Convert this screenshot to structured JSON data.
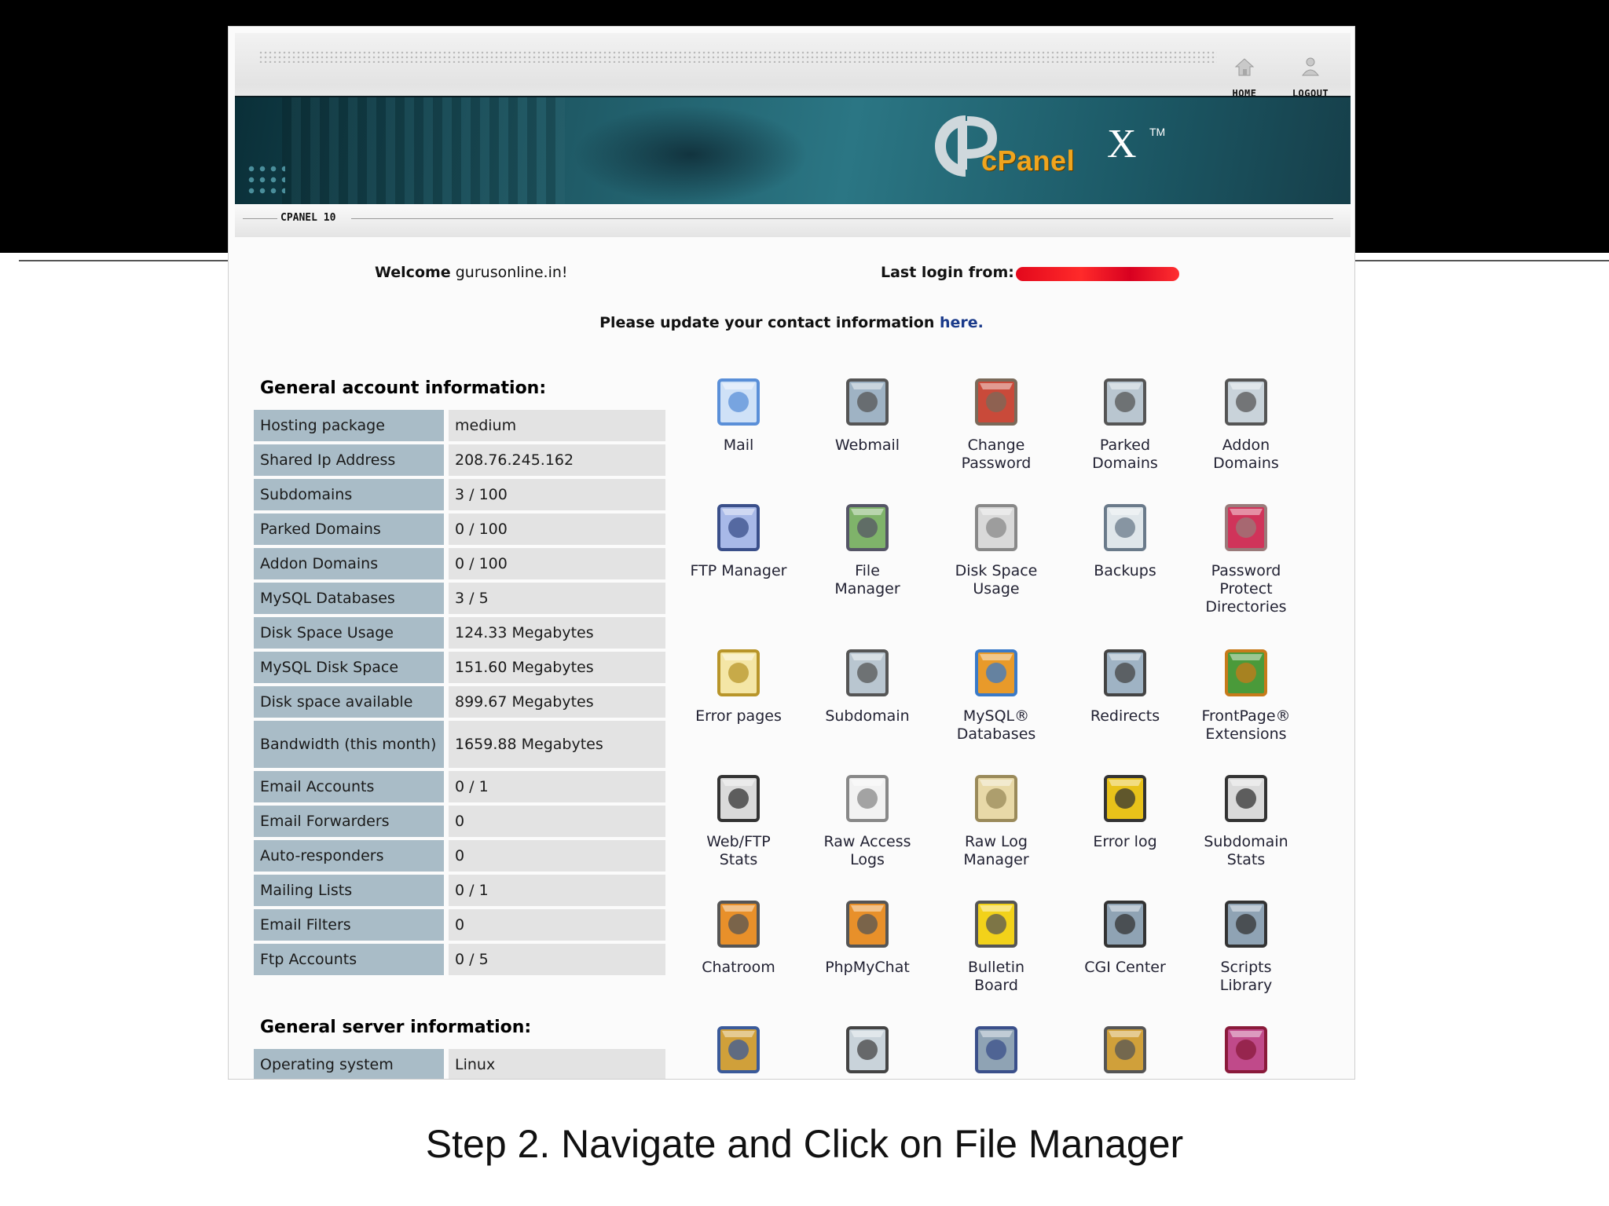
{
  "toolbar": {
    "home_label": "HOME",
    "logout_label": "LOGOUT"
  },
  "banner": {
    "logo_text": "cPanel",
    "logo_x": "X",
    "logo_tm": "TM"
  },
  "subbar": {
    "label": "CPANEL 10"
  },
  "welcome": {
    "prefix": "Welcome",
    "domain": "gurusonline.in!",
    "last_login_label": "Last login from:"
  },
  "notice": {
    "text": "Please update your contact information ",
    "link": "here."
  },
  "account": {
    "title": "General account information:",
    "rows": [
      {
        "k": "Hosting package",
        "v": "medium"
      },
      {
        "k": "Shared Ip Address",
        "v": "208.76.245.162"
      },
      {
        "k": "Subdomains",
        "v": "3 / 100"
      },
      {
        "k": "Parked Domains",
        "v": "0 / 100"
      },
      {
        "k": "Addon Domains",
        "v": "0 / 100"
      },
      {
        "k": "MySQL Databases",
        "v": "3 / 5"
      },
      {
        "k": "Disk Space Usage",
        "v": "124.33 Megabytes"
      },
      {
        "k": "MySQL Disk Space",
        "v": "151.60 Megabytes"
      },
      {
        "k": "Disk space available",
        "v": "899.67 Megabytes"
      },
      {
        "k": "Bandwidth (this month)",
        "v": "1659.88 Megabytes"
      },
      {
        "k": "Email Accounts",
        "v": "0 / 1"
      },
      {
        "k": "Email Forwarders",
        "v": "0"
      },
      {
        "k": "Auto-responders",
        "v": "0"
      },
      {
        "k": "Mailing Lists",
        "v": "0 / 1"
      },
      {
        "k": "Email Filters",
        "v": "0"
      },
      {
        "k": "Ftp Accounts",
        "v": "0 / 5"
      }
    ]
  },
  "server": {
    "title": "General server information:",
    "rows": [
      {
        "k": "Operating system",
        "v": "Linux"
      }
    ]
  },
  "icons": [
    {
      "label": "Mail",
      "icon": "mail-icon"
    },
    {
      "label": "Webmail",
      "icon": "webmail-icon"
    },
    {
      "label": "Change\nPassword",
      "icon": "change-password-icon"
    },
    {
      "label": "Parked\nDomains",
      "icon": "parked-domains-icon"
    },
    {
      "label": "Addon\nDomains",
      "icon": "addon-domains-icon"
    },
    {
      "label": "FTP Manager",
      "icon": "ftp-manager-icon"
    },
    {
      "label": "File\nManager",
      "icon": "file-manager-icon"
    },
    {
      "label": "Disk Space\nUsage",
      "icon": "disk-space-icon"
    },
    {
      "label": "Backups",
      "icon": "backups-icon"
    },
    {
      "label": "Password\nProtect\nDirectories",
      "icon": "password-protect-icon"
    },
    {
      "label": "Error pages",
      "icon": "error-pages-icon"
    },
    {
      "label": "Subdomain",
      "icon": "subdomain-icon"
    },
    {
      "label": "MySQL®\nDatabases",
      "icon": "mysql-icon"
    },
    {
      "label": "Redirects",
      "icon": "redirects-icon"
    },
    {
      "label": "FrontPage®\nExtensions",
      "icon": "frontpage-icon"
    },
    {
      "label": "Web/FTP\nStats",
      "icon": "web-ftp-stats-icon"
    },
    {
      "label": "Raw Access\nLogs",
      "icon": "raw-access-logs-icon"
    },
    {
      "label": "Raw Log\nManager",
      "icon": "raw-log-manager-icon"
    },
    {
      "label": "Error log",
      "icon": "error-log-icon"
    },
    {
      "label": "Subdomain\nStats",
      "icon": "subdomain-stats-icon"
    },
    {
      "label": "Chatroom",
      "icon": "chatroom-icon"
    },
    {
      "label": "PhpMyChat",
      "icon": "phpmychat-icon"
    },
    {
      "label": "Bulletin\nBoard",
      "icon": "bulletin-board-icon"
    },
    {
      "label": "CGI Center",
      "icon": "cgi-center-icon"
    },
    {
      "label": "Scripts\nLibrary",
      "icon": "scripts-library-icon"
    },
    {
      "label": "",
      "icon": "shopping-cart-icon"
    },
    {
      "label": "",
      "icon": "cron-jobs-icon"
    },
    {
      "label": "",
      "icon": "network-tools-icon"
    },
    {
      "label": "",
      "icon": "settings-gear-icon"
    },
    {
      "label": "",
      "icon": "apache-logo-icon"
    }
  ],
  "caption": "Step 2. Navigate and Click on File Manager",
  "colors": {
    "key_cell": "#a9bcc7",
    "value_cell": "#e3e3e3",
    "banner": "#1f5a66",
    "logo_orange": "#f0a51e",
    "link": "#1a3a8a"
  }
}
